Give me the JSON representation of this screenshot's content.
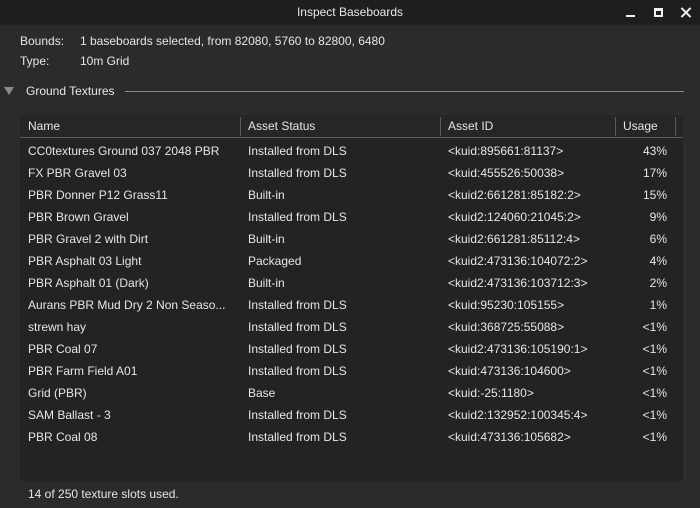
{
  "window": {
    "title": "Inspect Baseboards",
    "minimize_icon": "minimize-icon",
    "maximize_icon": "maximize-icon",
    "close_icon": "close-icon"
  },
  "info": {
    "bounds_label": "Bounds:",
    "bounds_value": "1 baseboards selected, from 82080, 5760 to 82800, 6480",
    "type_label": "Type:",
    "type_value": "10m Grid"
  },
  "section": {
    "title": "Ground Textures",
    "toggle_icon": "triangle-down-icon"
  },
  "table": {
    "columns": [
      "Name",
      "Asset Status",
      "Asset ID",
      "Usage"
    ],
    "rows": [
      {
        "name": "CC0textures Ground 037 2048 PBR",
        "status": "Installed from DLS",
        "asset_id": "<kuid:895661:81137>",
        "usage": "43%"
      },
      {
        "name": "FX PBR Gravel 03",
        "status": "Installed from DLS",
        "asset_id": "<kuid:455526:50038>",
        "usage": "17%"
      },
      {
        "name": "PBR Donner P12 Grass11",
        "status": "Built-in",
        "asset_id": "<kuid2:661281:85182:2>",
        "usage": "15%"
      },
      {
        "name": "PBR Brown Gravel",
        "status": "Installed from DLS",
        "asset_id": "<kuid2:124060:21045:2>",
        "usage": "9%"
      },
      {
        "name": "PBR Gravel 2 with Dirt",
        "status": "Built-in",
        "asset_id": "<kuid2:661281:85112:4>",
        "usage": "6%"
      },
      {
        "name": "PBR Asphalt 03 Light",
        "status": "Packaged",
        "asset_id": "<kuid2:473136:104072:2>",
        "usage": "4%"
      },
      {
        "name": "PBR Asphalt 01 (Dark)",
        "status": "Built-in",
        "asset_id": "<kuid2:473136:103712:3>",
        "usage": "2%"
      },
      {
        "name": "Aurans PBR Mud Dry 2 Non Seaso...",
        "status": "Installed from DLS",
        "asset_id": "<kuid:95230:105155>",
        "usage": "1%"
      },
      {
        "name": "strewn hay",
        "status": "Installed from DLS",
        "asset_id": "<kuid:368725:55088>",
        "usage": "<1%"
      },
      {
        "name": "PBR Coal 07",
        "status": "Installed from DLS",
        "asset_id": "<kuid2:473136:105190:1>",
        "usage": "<1%"
      },
      {
        "name": "PBR Farm Field A01",
        "status": "Installed from DLS",
        "asset_id": "<kuid:473136:104600>",
        "usage": "<1%"
      },
      {
        "name": "Grid (PBR)",
        "status": "Base",
        "asset_id": "<kuid:-25:1180>",
        "usage": "<1%"
      },
      {
        "name": "SAM Ballast - 3",
        "status": "Installed from DLS",
        "asset_id": "<kuid2:132952:100345:4>",
        "usage": "<1%"
      },
      {
        "name": "PBR Coal 08",
        "status": "Installed from DLS",
        "asset_id": "<kuid:473136:105682>",
        "usage": "<1%"
      }
    ]
  },
  "footer": {
    "text": "14 of 250 texture slots used."
  }
}
